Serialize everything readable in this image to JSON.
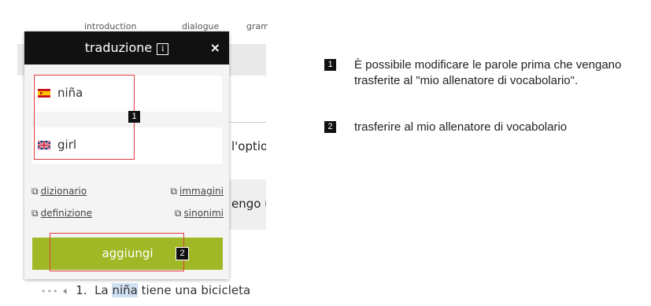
{
  "background": {
    "tabs": [
      "introduction",
      "dialogue",
      "gram"
    ],
    "partial_text_1": "l'optio",
    "partial_text_2": "engo u",
    "example": {
      "number": "1.",
      "before": "La ",
      "highlight": "niña",
      "after": " tiene una bicicleta"
    }
  },
  "popup": {
    "title": "traduzione",
    "info_icon": "i",
    "close_icon": "×",
    "spanish_word": "niña",
    "english_word": "girl",
    "links": {
      "dictionary": "dizionario",
      "images": "immagini",
      "definition": "definizione",
      "synonyms": "sinonimi"
    },
    "add_button": "aggiungi"
  },
  "markers": {
    "one": "1",
    "two": "2"
  },
  "notes": [
    {
      "number": "1",
      "text": "È possibile modificare le parole prima che vengano trasferite al \"mio allenatore di vocabolario\"."
    },
    {
      "number": "2",
      "text": "trasferire al mio allenatore di vocabolario"
    }
  ],
  "colors": {
    "header": "#111111",
    "add_button": "#a1b826",
    "annotation": "#e23a3a",
    "highlight": "#cfe0f2"
  }
}
